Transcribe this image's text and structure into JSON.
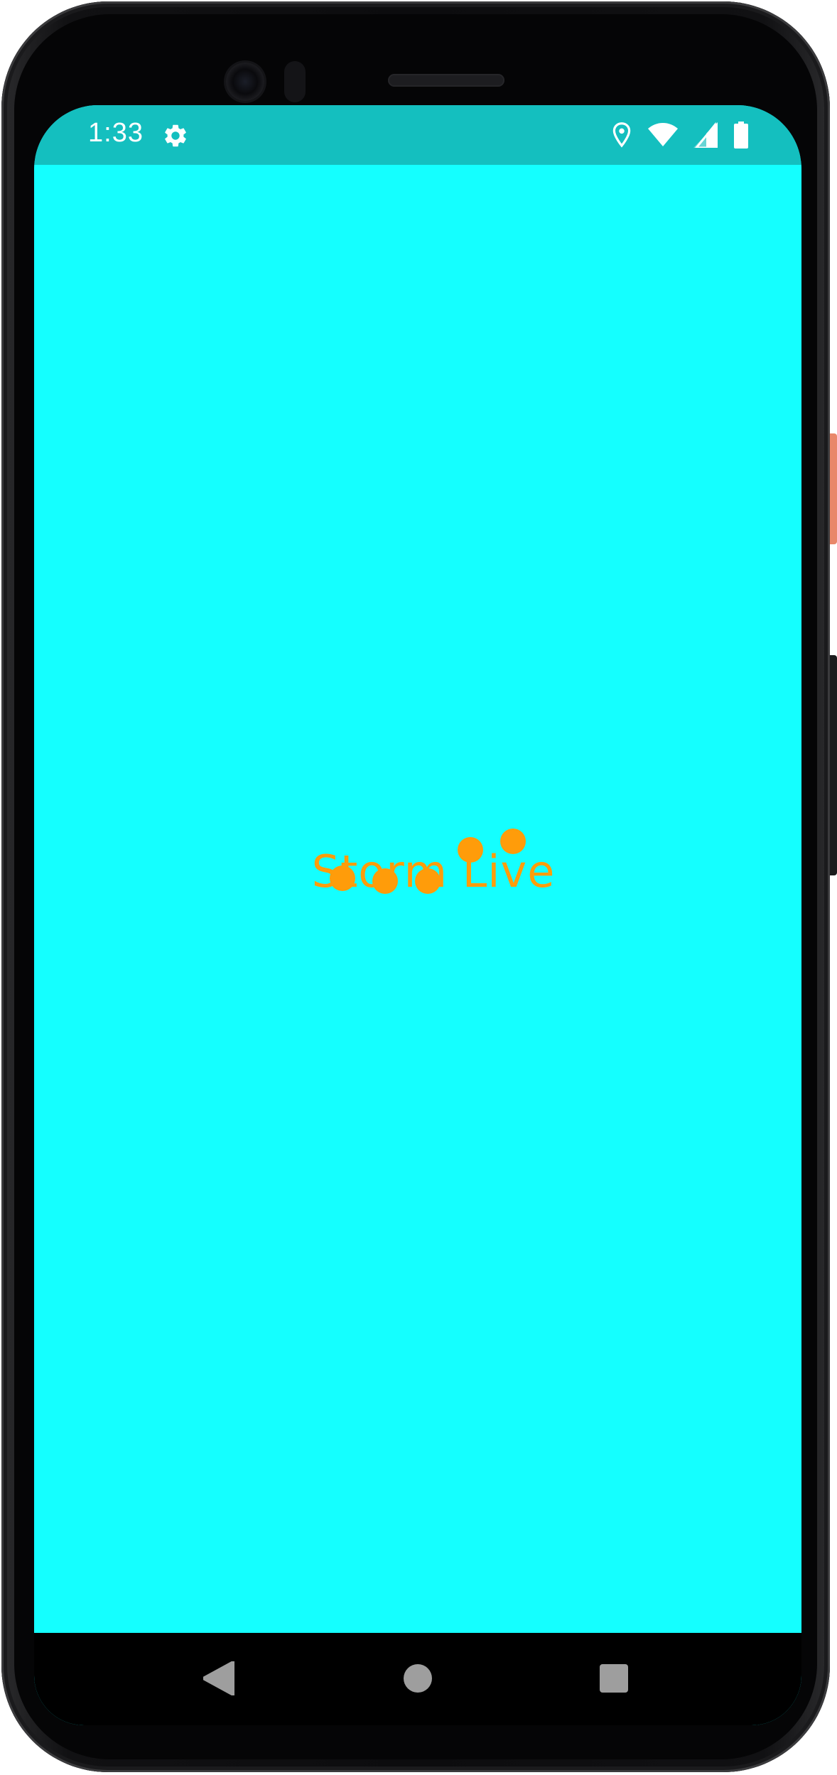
{
  "status_bar": {
    "time": "1:33",
    "background": "#14bfbf",
    "icons": [
      "gear-icon",
      "location-icon",
      "wifi-icon",
      "signal-icon",
      "battery-icon"
    ]
  },
  "splash": {
    "title": "Storm Live",
    "title_color": "#ff9c0a",
    "background": "#14ffff",
    "loading_dots": 5
  },
  "nav_bar": {
    "buttons": [
      "back-icon",
      "home-icon",
      "recents-icon"
    ]
  }
}
